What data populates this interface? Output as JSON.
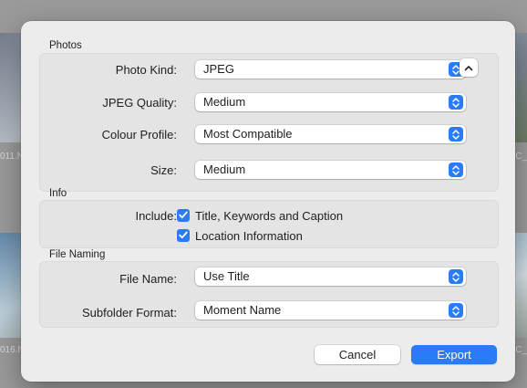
{
  "background": {
    "filenames": [
      "011.N",
      "SC_",
      "016.N",
      "SC_"
    ]
  },
  "dialog": {
    "sections": {
      "photos": {
        "title": "Photos",
        "photo_kind_label": "Photo Kind:",
        "photo_kind_value": "JPEG",
        "jpeg_quality_label": "JPEG Quality:",
        "jpeg_quality_value": "Medium",
        "colour_profile_label": "Colour Profile:",
        "colour_profile_value": "Most Compatible",
        "size_label": "Size:",
        "size_value": "Medium"
      },
      "info": {
        "title": "Info",
        "include_label": "Include:",
        "options": [
          {
            "label": "Title, Keywords and Caption",
            "checked": true
          },
          {
            "label": "Location Information",
            "checked": true
          }
        ]
      },
      "file_naming": {
        "title": "File Naming",
        "file_name_label": "File Name:",
        "file_name_value": "Use Title",
        "subfolder_label": "Subfolder Format:",
        "subfolder_value": "Moment Name"
      }
    },
    "buttons": {
      "cancel": "Cancel",
      "export": "Export"
    }
  },
  "colors": {
    "accent": "#2a7cf6",
    "dialog_bg": "#ececec"
  }
}
